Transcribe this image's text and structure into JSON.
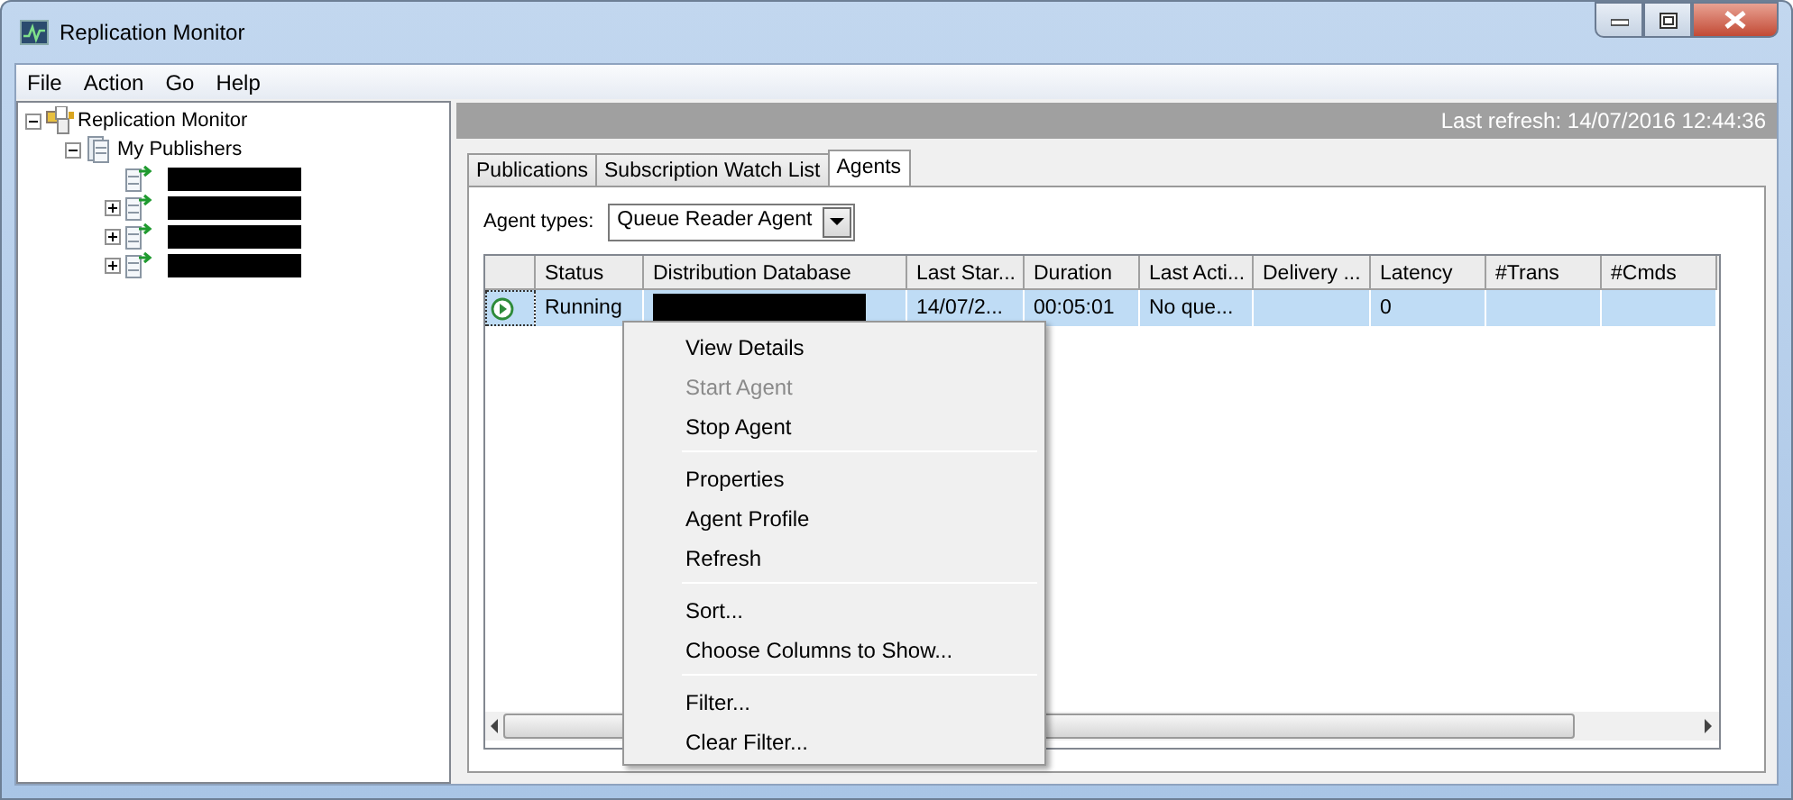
{
  "window": {
    "title": "Replication Monitor"
  },
  "menu": [
    "File",
    "Action",
    "Go",
    "Help"
  ],
  "tree": {
    "label": "Replication Monitor",
    "kind": "root",
    "expanded": true,
    "children": [
      {
        "label": "My Publishers",
        "kind": "group",
        "expanded": true,
        "children": [
          {
            "kind": "redacted"
          },
          {
            "kind": "redacted",
            "expanded": false
          },
          {
            "kind": "redacted",
            "expanded": false
          },
          {
            "kind": "redacted",
            "expanded": false
          }
        ]
      }
    ]
  },
  "status_bar": {
    "text": "Last refresh: 14/07/2016 12:44:36"
  },
  "tabs": [
    {
      "label": "Publications",
      "selected": false
    },
    {
      "label": "Subscription Watch List",
      "selected": false
    },
    {
      "label": "Agents",
      "selected": true
    }
  ],
  "agent_types": {
    "label": "Agent types:",
    "value": "Queue Reader Agent"
  },
  "table": {
    "columns": [
      "Status",
      "Distribution Database",
      "Last Star...",
      "Duration",
      "Last Acti...",
      "Delivery ...",
      "Latency",
      "#Trans",
      "#Cmds"
    ],
    "rows": [
      {
        "selected": true,
        "kind": "running",
        "cells": [
          "Running",
          {
            "kind": "redacted"
          },
          "14/07/2...",
          "00:05:01",
          "No que...",
          null,
          "0",
          null,
          null
        ]
      }
    ]
  },
  "context_menu": [
    {
      "kind": "item",
      "label": "View Details",
      "disabled": false
    },
    {
      "kind": "item",
      "label": "Start Agent",
      "disabled": true
    },
    {
      "kind": "item",
      "label": "Stop Agent",
      "disabled": false
    },
    {
      "kind": "separator"
    },
    {
      "kind": "item",
      "label": "Properties",
      "disabled": false
    },
    {
      "kind": "item",
      "label": "Agent Profile",
      "disabled": false
    },
    {
      "kind": "item",
      "label": "Refresh",
      "disabled": false
    },
    {
      "kind": "separator"
    },
    {
      "kind": "item",
      "label": "Sort...",
      "disabled": false
    },
    {
      "kind": "item",
      "label": "Choose Columns to Show...",
      "disabled": false
    },
    {
      "kind": "separator"
    },
    {
      "kind": "item",
      "label": "Filter...",
      "disabled": false
    },
    {
      "kind": "item",
      "label": "Clear Filter...",
      "disabled": false
    }
  ]
}
